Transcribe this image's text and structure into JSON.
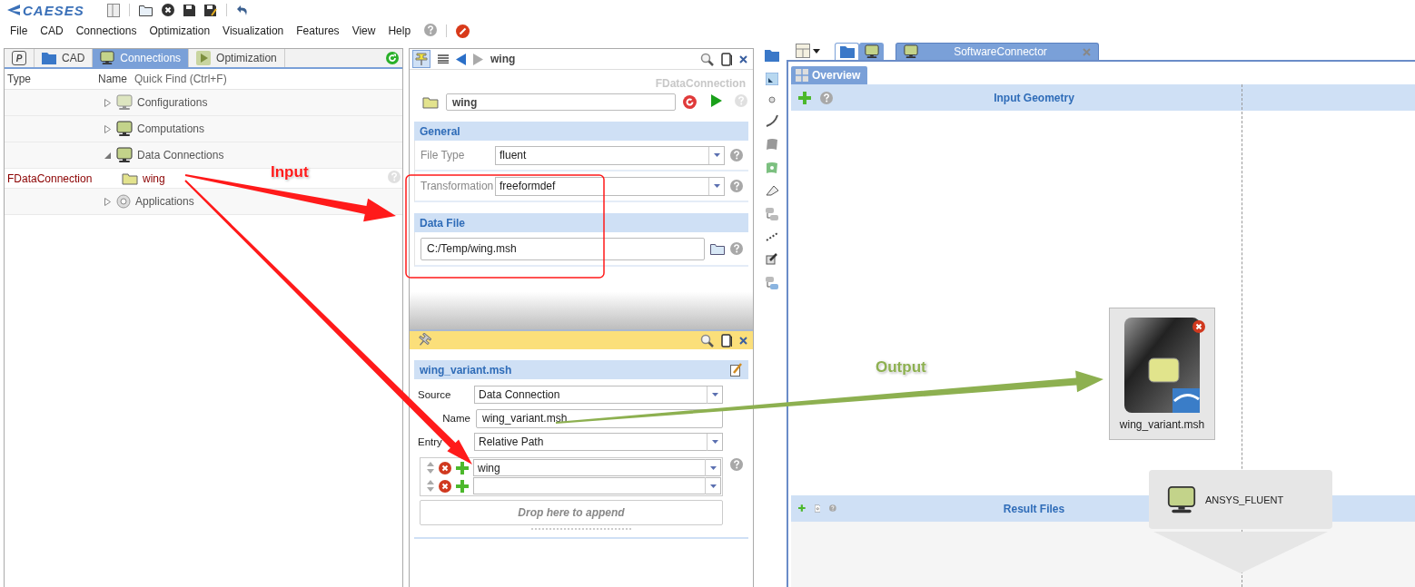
{
  "app": {
    "logo": "CAESES"
  },
  "menu": [
    "File",
    "CAD",
    "Connections",
    "Optimization",
    "Visualization",
    "Features",
    "View",
    "Help"
  ],
  "left_panel": {
    "tabs": [
      {
        "label": "P",
        "kind": "letter",
        "selected": false
      },
      {
        "label": "CAD",
        "kind": "folder",
        "selected": false
      },
      {
        "label": "Connections",
        "kind": "monitor",
        "selected": true
      },
      {
        "label": "Optimization",
        "kind": "play",
        "selected": false
      }
    ],
    "columns": [
      "Type",
      "Name"
    ],
    "quick_find": {
      "placeholder": "Quick Find (Ctrl+F)"
    },
    "tree": [
      {
        "name": "Configurations",
        "kind": "category",
        "expanded": false,
        "disabled": true
      },
      {
        "name": "Computations",
        "kind": "category",
        "expanded": false,
        "disabled": false
      },
      {
        "name": "Data Connections",
        "kind": "category",
        "expanded": true,
        "disabled": false,
        "children": [
          {
            "type": "FDataConnection",
            "name": "wing",
            "kind": "connection"
          }
        ]
      },
      {
        "name": "Applications",
        "kind": "application",
        "expanded": false,
        "disabled": false
      }
    ]
  },
  "editor": {
    "title": "wing",
    "object_type": "FDataConnection",
    "name": "wing",
    "sections": [
      {
        "title": "General",
        "fields": [
          {
            "label": "File Type",
            "value": "fluent",
            "kind": "dropdown"
          },
          {
            "label": "Transformation",
            "value": "freeformdef",
            "kind": "dropdown"
          }
        ]
      },
      {
        "title": "Data File",
        "fields": [
          {
            "value": "C:/Temp/wing.msh",
            "kind": "file"
          }
        ]
      }
    ]
  },
  "file_panel": {
    "title": "wing_variant.msh",
    "fields": [
      {
        "label": "Source",
        "value": "Data Connection",
        "kind": "dropdown"
      },
      {
        "label": "Name",
        "value": "wing_variant.msh",
        "kind": "text"
      },
      {
        "label": "Entry",
        "value": "Relative Path",
        "kind": "dropdown"
      }
    ],
    "entries": [
      {
        "kind": "value",
        "value": "wing"
      },
      {
        "kind": "empty"
      }
    ],
    "drop_hint": "Drop here to append"
  },
  "connector": {
    "tab": "SoftwareConnector",
    "subtab": "Overview",
    "input_section": "Input Geometry",
    "result_section": "Result Files",
    "input_file": "wing_variant.msh",
    "application": "ANSYS_FLUENT"
  },
  "annotations": [
    {
      "text": "Input",
      "color": "#ff1a1a"
    },
    {
      "text": "Output",
      "color": "#8db050"
    }
  ]
}
